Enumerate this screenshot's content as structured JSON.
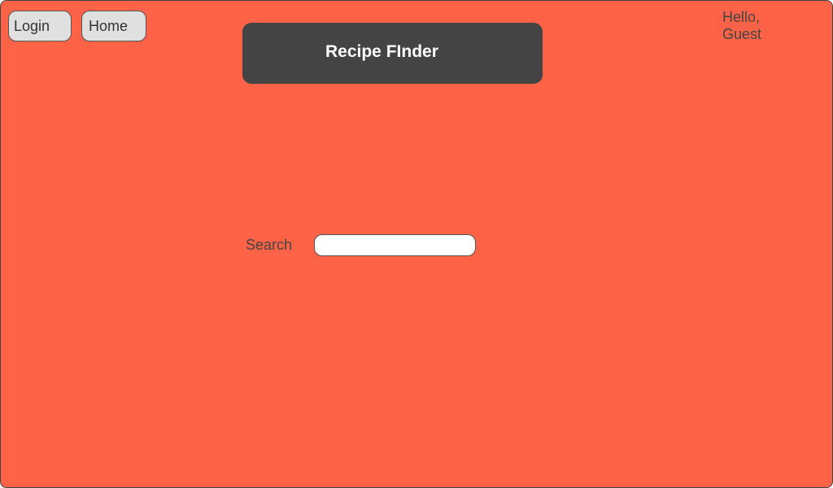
{
  "app": {
    "title": "Recipe FInder"
  },
  "nav": {
    "login_label": "Login",
    "home_label": "Home"
  },
  "greeting": {
    "line1": "Hello,",
    "line2": "Guest"
  },
  "search": {
    "label": "Search",
    "value": "",
    "placeholder": ""
  },
  "colors": {
    "background": "#FF6347",
    "title_bar": "#444444",
    "button_fill": "#E0E0E0",
    "text": "#444444"
  }
}
